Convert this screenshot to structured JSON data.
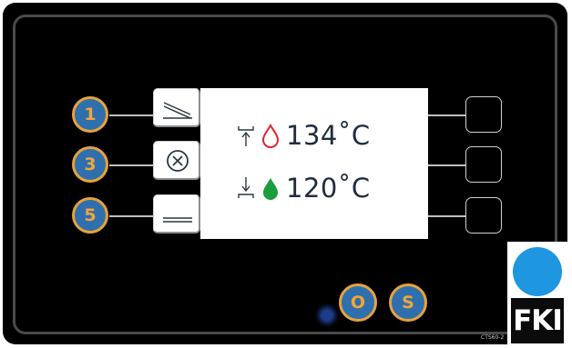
{
  "buttons_left": [
    {
      "label": "1"
    },
    {
      "label": "3"
    },
    {
      "label": "5"
    }
  ],
  "bottom_buttons": [
    {
      "label": "O"
    },
    {
      "label": "S"
    }
  ],
  "display": {
    "upper_temp": "134˚C",
    "lower_temp": "120˚C"
  },
  "brand": {
    "logo_text": "FKI",
    "model": "CTS60-2"
  },
  "colors": {
    "panel": "#000000",
    "button_fill": "#2f6fae",
    "button_ring": "#e7a33b",
    "drop_outline": "#e0232e",
    "drop_fill": "#1a9e3c",
    "logo_blue": "#1e96e0",
    "text_dark": "#1f2d3f"
  },
  "icons": {
    "key_1": "steep-slope-icon",
    "key_3": "cancel-circle-x-icon",
    "key_5": "flat-lines-icon",
    "upper_probe": "valve-up-arrow-icon",
    "lower_probe": "valve-down-arrow-icon",
    "upper_drop": "red-drop-outline-icon",
    "lower_drop": "green-drop-filled-icon"
  }
}
